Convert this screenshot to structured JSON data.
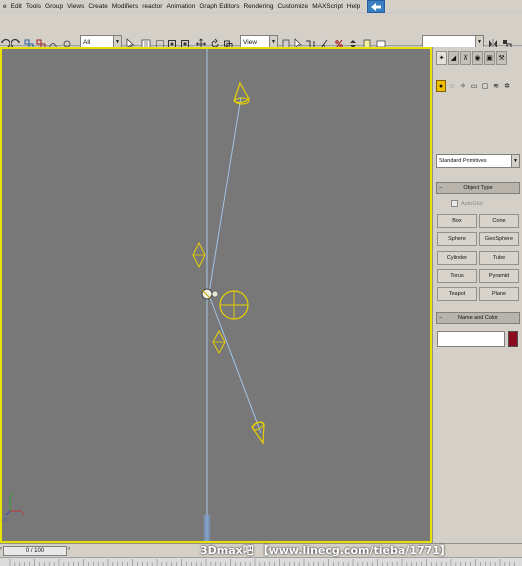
{
  "menu": [
    "e",
    "Edit",
    "Tools",
    "Group",
    "Views",
    "Create",
    "Modifiers",
    "reactor",
    "Animation",
    "Graph Editors",
    "Rendering",
    "Customize",
    "MAXScript",
    "Help"
  ],
  "toolbar": {
    "selection_filter": "All",
    "ref_coord": "View",
    "named_selection": ""
  },
  "command_panel": {
    "category": "Standard Primitives",
    "object_type_header": "Object Type",
    "autogrid_label": "AutoGrid",
    "primitives": [
      "Box",
      "Cone",
      "Sphere",
      "GeoSphere",
      "Cylinder",
      "Tube",
      "Torus",
      "Pyramid",
      "Teapot",
      "Plane"
    ],
    "name_color_header": "Name and Color",
    "object_color": "#8b0a1e"
  },
  "timeline": {
    "frame_display": "0 / 100"
  },
  "watermark": "3Dmax吧 【www.linecg.com/tieba/1771】",
  "colors": {
    "viewport_bg": "#787878",
    "active_border": "#e8e000",
    "gizmo": "#e8d000",
    "guide_line": "#9fc4e8"
  }
}
